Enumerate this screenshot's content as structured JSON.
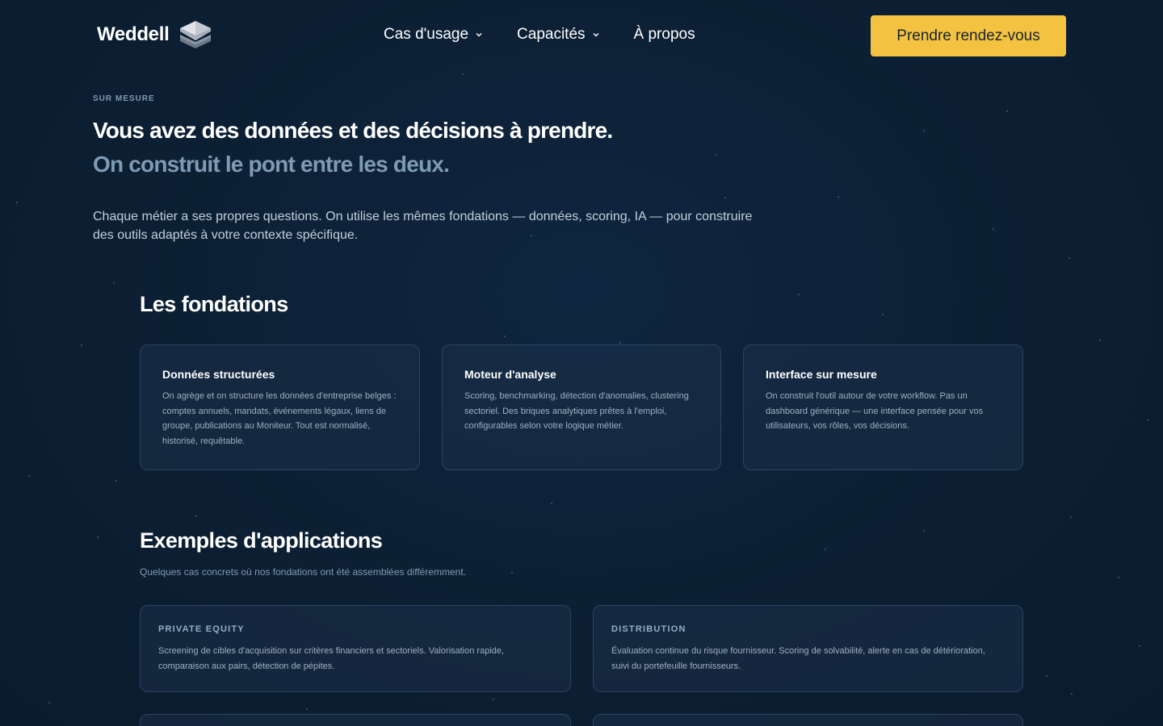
{
  "header": {
    "logo_text": "Weddell",
    "logo_icon": "stacked-layers-icon",
    "nav": [
      {
        "label": "Cas d'usage",
        "has_dropdown": true
      },
      {
        "label": "Capacités",
        "has_dropdown": true
      },
      {
        "label": "À propos",
        "has_dropdown": false
      }
    ],
    "cta_label": "Prendre rendez-vous"
  },
  "hero": {
    "eyebrow": "SUR MESURE",
    "title": "Vous avez des données et des décisions à prendre.",
    "subtitle": "On construit le pont entre les deux.",
    "text": "Chaque métier a ses propres questions. On utilise les mêmes fondations — données, scoring, IA — pour construire des outils adaptés à votre contexte spécifique."
  },
  "foundations": {
    "title": "Les fondations",
    "cards": [
      {
        "title": "Données structurées",
        "text": "On agrège et on structure les données d'entreprise belges : comptes annuels, mandats, événements légaux, liens de groupe, publications au Moniteur. Tout est normalisé, historisé, requêtable."
      },
      {
        "title": "Moteur d'analyse",
        "text": "Scoring, benchmarking, détection d'anomalies, clustering sectoriel. Des briques analytiques prêtes à l'emploi, configurables selon votre logique métier."
      },
      {
        "title": "Interface sur mesure",
        "text": "On construit l'outil autour de votre workflow. Pas un dashboard générique — une interface pensée pour vos utilisateurs, vos rôles, vos décisions."
      }
    ]
  },
  "applications": {
    "title": "Exemples d'applications",
    "subtitle": "Quelques cas concrets où nos fondations ont été assemblées différemment.",
    "cards": [
      {
        "label": "PRIVATE EQUITY",
        "text": "Screening de cibles d'acquisition sur critères financiers et sectoriels. Valorisation rapide, comparaison aux pairs, détection de pépites."
      },
      {
        "label": "DISTRIBUTION",
        "text": "Évaluation continue du risque fournisseur. Scoring de solvabilité, alerte en cas de détérioration, suivi du portefeuille fournisseurs."
      }
    ]
  },
  "colors": {
    "background": "#0c1f33",
    "accent": "#f2c240",
    "muted_heading": "#7f9bb4",
    "card_border": "#2c4360"
  }
}
